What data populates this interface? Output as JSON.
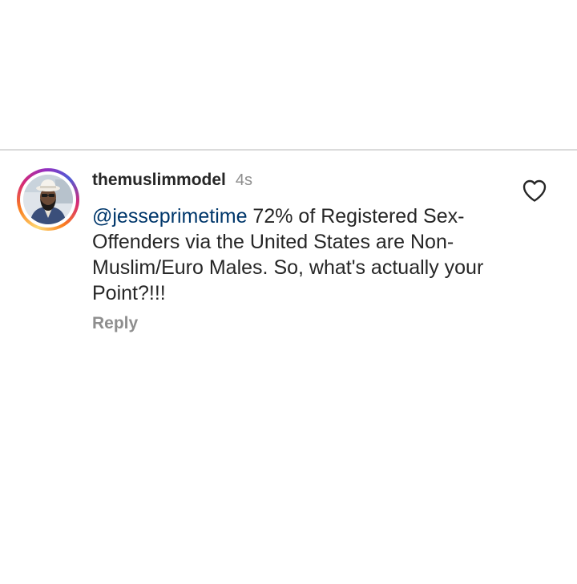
{
  "comment": {
    "username": "themuslimmodel",
    "timestamp": "4s",
    "mention": "@jesseprimetime",
    "text": " 72% of Registered Sex-Offenders via the United States are Non-Muslim/Euro Males. So, what's actually your Point?!!!",
    "reply_label": "Reply",
    "avatar_icon": "profile-photo",
    "like_icon": "heart-outline-icon"
  },
  "colors": {
    "mention": "#00376b",
    "secondary_text": "#8e8e8e",
    "primary_text": "#262626",
    "divider": "#dbdbdb"
  }
}
